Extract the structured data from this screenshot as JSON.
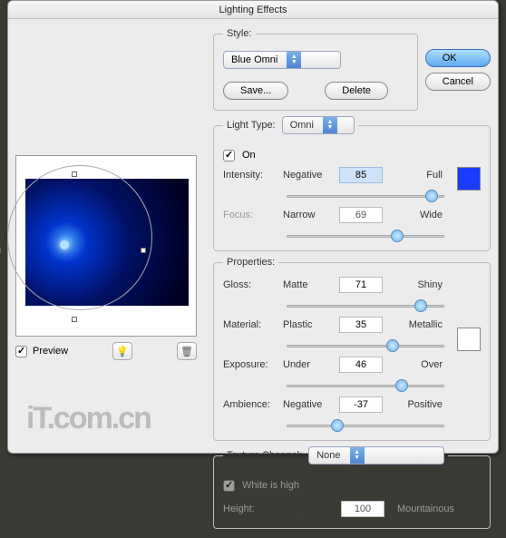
{
  "title": "Lighting Effects",
  "buttons": {
    "ok": "OK",
    "cancel": "Cancel",
    "save": "Save...",
    "delete": "Delete"
  },
  "style": {
    "label": "Style:",
    "value": "Blue Omni"
  },
  "preview": {
    "label": "Preview"
  },
  "light": {
    "legend": "Light Type:",
    "type": "Omni",
    "on_label": "On",
    "intensity": {
      "label": "Intensity:",
      "left": "Negative",
      "right": "Full",
      "value": "85",
      "pct": 92
    },
    "focus": {
      "label": "Focus:",
      "left": "Narrow",
      "right": "Wide",
      "value": "69",
      "pct": 70
    },
    "swatch_color": "#1a3cff"
  },
  "properties": {
    "legend": "Properties:",
    "gloss": {
      "label": "Gloss:",
      "left": "Matte",
      "right": "Shiny",
      "value": "71",
      "pct": 85
    },
    "material": {
      "label": "Material:",
      "left": "Plastic",
      "right": "Metallic",
      "value": "35",
      "pct": 67
    },
    "exposure": {
      "label": "Exposure:",
      "left": "Under",
      "right": "Over",
      "value": "46",
      "pct": 73
    },
    "ambience": {
      "label": "Ambience:",
      "left": "Negative",
      "right": "Positive",
      "value": "-37",
      "pct": 32
    },
    "swatch_color": "#ffffff"
  },
  "texture": {
    "legend": "Texture Channel:",
    "value": "None",
    "white_label": "White is high",
    "height": {
      "label": "Height:",
      "left": "Flat",
      "right": "Mountainous",
      "value": "100"
    }
  },
  "logo": "iT.com.cn"
}
